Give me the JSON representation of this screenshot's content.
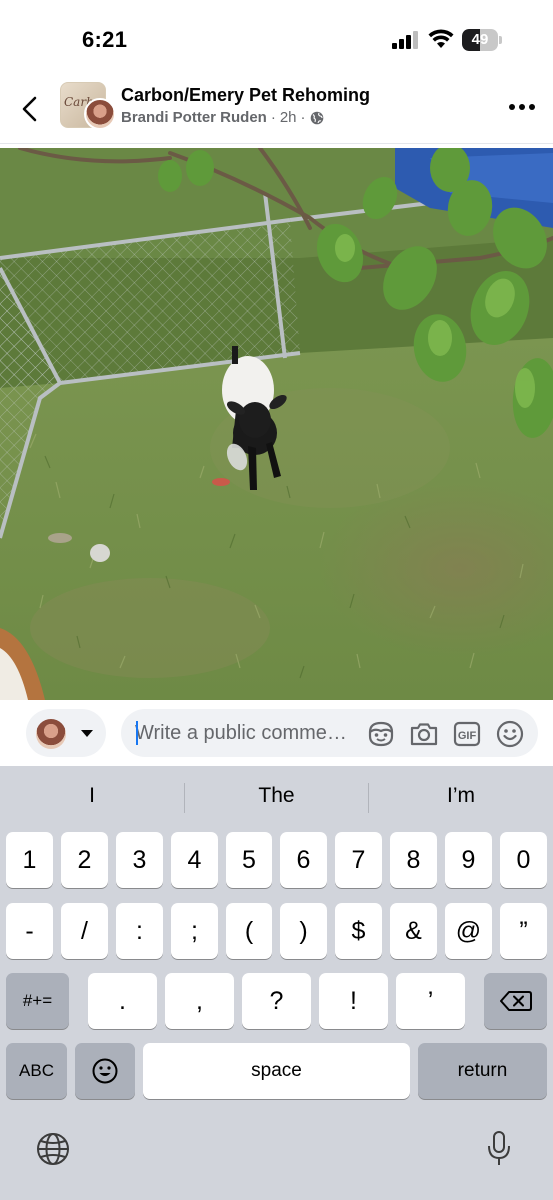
{
  "status_bar": {
    "time": "6:21",
    "battery_level": "49",
    "battery_fraction": 0.49,
    "icons": [
      "cellular-signal-icon",
      "wifi-icon",
      "battery-icon"
    ]
  },
  "header": {
    "group_name": "Carbon/Emery Pet Rehoming",
    "author": "Brandi Potter Ruden",
    "time_ago": "2h",
    "separator": "·",
    "privacy_icon": "globe-icon",
    "avatar_text": "Carbon",
    "back_icon": "chevron-left-icon",
    "more_icon": "more-dots-icon"
  },
  "photo": {
    "icon": "photo-goat-in-pen"
  },
  "comment_bar": {
    "placeholder": "Write a public comme…",
    "icons": [
      "avatar-sticker-icon",
      "camera-icon",
      "gif-icon",
      "emoji-icon"
    ]
  },
  "keyboard": {
    "suggestions": [
      "I",
      "The",
      "I’m"
    ],
    "row1": [
      "1",
      "2",
      "3",
      "4",
      "5",
      "6",
      "7",
      "8",
      "9",
      "0"
    ],
    "row2": [
      "-",
      "/",
      ":",
      ";",
      "(",
      ")",
      "$",
      "&",
      "@",
      "”"
    ],
    "row3": [
      ".",
      ",",
      "?",
      "!",
      "’"
    ],
    "symbols_key": "#+=",
    "abc_key": "ABC",
    "space_key": "space",
    "return_key": "return"
  },
  "colors": {
    "accent": "#1877f2",
    "keyboard_bg": "#d1d4db",
    "key_dark": "#abb0ba",
    "meta_text": "#65676b"
  }
}
